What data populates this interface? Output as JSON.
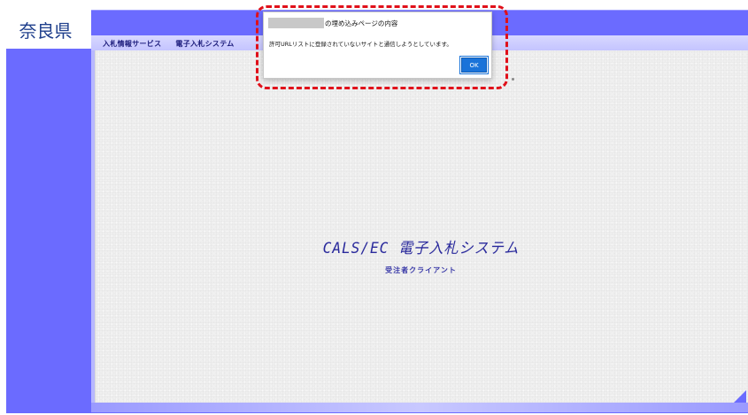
{
  "prefecture": "奈良県",
  "nav": {
    "items": [
      "入札情報サービス",
      "電子入札システム"
    ]
  },
  "main": {
    "title": "CALS/EC 電子入札システム",
    "subtitle": "受注者クライアント"
  },
  "dialog": {
    "title_suffix": "の埋め込みページの内容",
    "message": "許可URLリストに登録されていないサイトと通信しようとしています。",
    "ok_label": "OK"
  },
  "colors": {
    "frame": "#6b6bff",
    "content": "#efefef",
    "title_text": "#2a2a9c",
    "ok_button": "#1a73d9",
    "highlight": "#e0101a"
  }
}
